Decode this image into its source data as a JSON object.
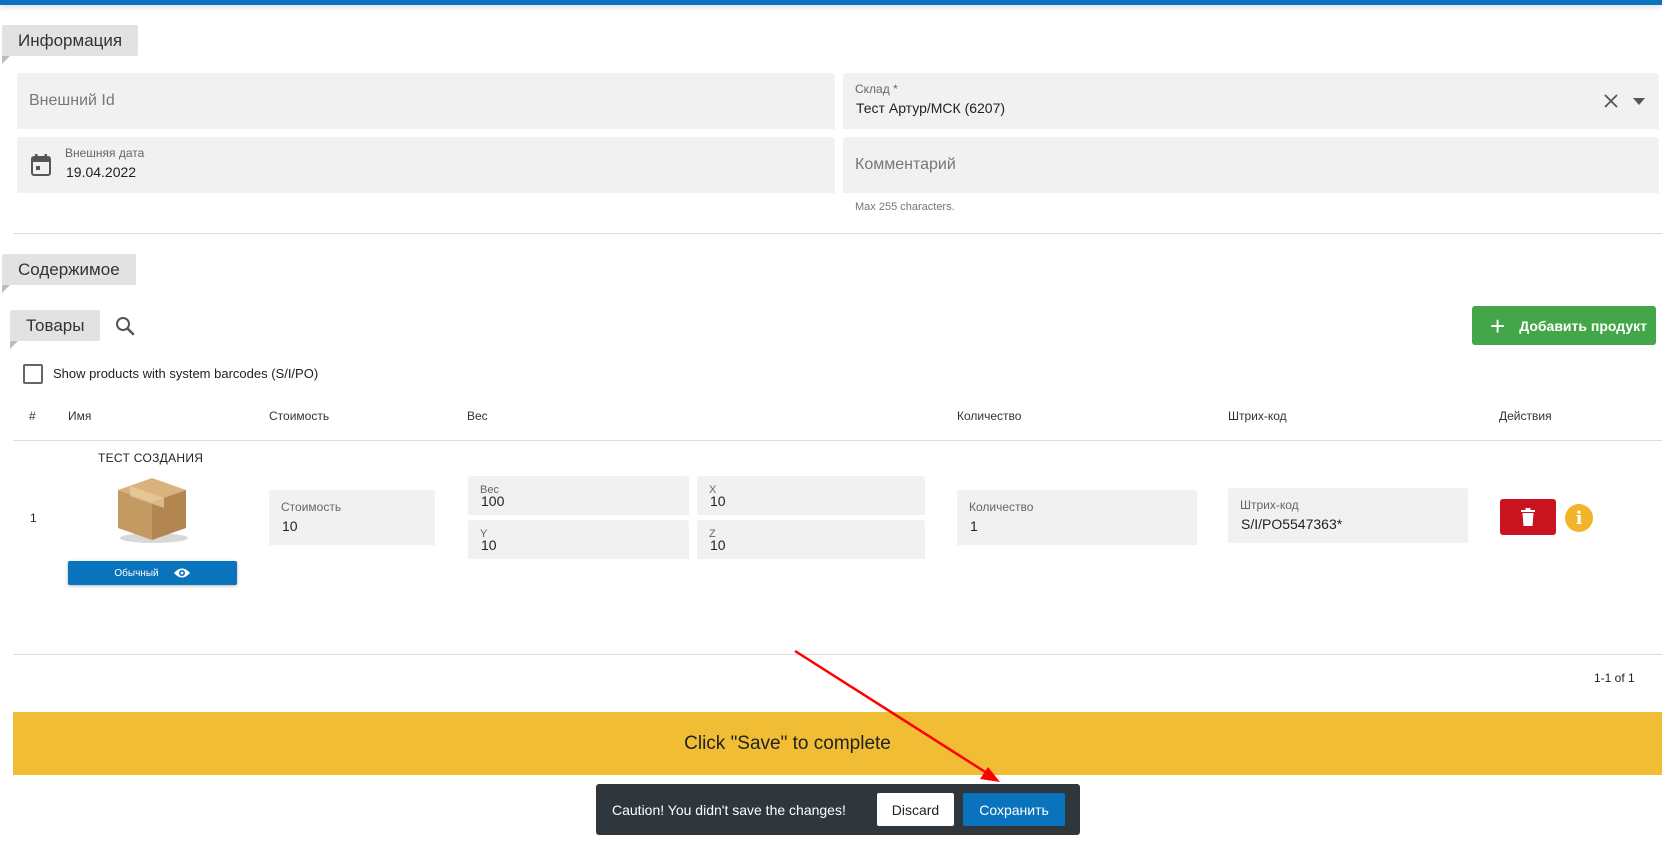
{
  "sections": {
    "info": "Информация",
    "contents": "Содержимое",
    "goods_tab": "Товары"
  },
  "form": {
    "external_id_placeholder": "Внешний Id",
    "warehouse": {
      "label": "Склад *",
      "value": "Тест Артур/МСК (6207)"
    },
    "external_date": {
      "label": "Внешняя дата",
      "value": "19.04.2022"
    },
    "comment_placeholder": "Комментарий",
    "comment_hint": "Max 255 characters."
  },
  "toolbar": {
    "add_product_label": "Добавить продукт",
    "show_system_barcodes": "Show products with system barcodes (S/I/PO)"
  },
  "table": {
    "headers": {
      "num": "#",
      "name": "Имя",
      "cost": "Стоимость",
      "weight": "Вес",
      "quantity": "Количество",
      "barcode": "Штрих-код",
      "actions": "Действия"
    },
    "rows": [
      {
        "num": "1",
        "name": "ТЕСТ СОЗДАНИЯ",
        "type_label": "Обычный",
        "cost_label": "Стоимость",
        "cost": "10",
        "weight_label": "Вес",
        "weight": "100",
        "x_label": "X",
        "x": "10",
        "y_label": "Y",
        "y": "10",
        "z_label": "Z",
        "z": "10",
        "quantity_label": "Количество",
        "quantity": "1",
        "barcode_label": "Штрих-код",
        "barcode": "S/I/PO5547363*"
      }
    ],
    "pagination": "1-1 of 1"
  },
  "banner": "Click \"Save\" to complete",
  "snackbar": {
    "message": "Caution! You didn't save the changes!",
    "discard_label": "Discard",
    "save_label": "Сохранить"
  },
  "colors": {
    "primary": "#0a73be",
    "success": "#43a648",
    "danger": "#c9131e",
    "warning": "#f0bd35",
    "annotation_arrow": "#ff0000"
  }
}
